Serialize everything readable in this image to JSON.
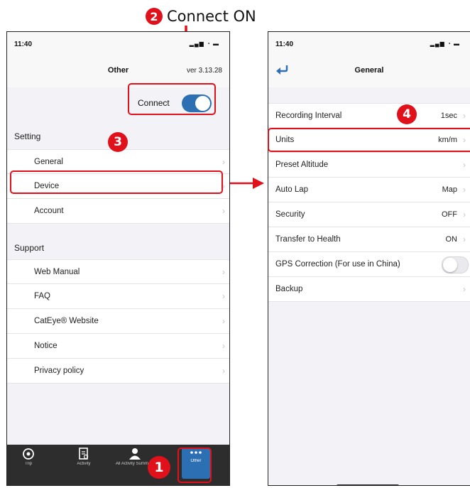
{
  "annotations": {
    "step1": "1",
    "step2": "2",
    "step2_label": "Connect ON",
    "step3": "3",
    "step4": "4",
    "accent_color": "#e0111b"
  },
  "left_screen": {
    "status_time": "11:40",
    "title": "Other",
    "version": "ver 3.13.28",
    "connect_label": "Connect",
    "connect_on": true,
    "sections": [
      {
        "header": "Setting",
        "items": [
          "General",
          "Device",
          "Account"
        ]
      },
      {
        "header": "Support",
        "items": [
          "Web Manual",
          "FAQ",
          "CatEye® Website",
          "Notice",
          "Privacy policy"
        ]
      }
    ],
    "tabs": [
      {
        "label": "Trip",
        "icon": "trip-icon"
      },
      {
        "label": "Activity",
        "icon": "activity-icon"
      },
      {
        "label": "All Activity Summary",
        "icon": "person-icon"
      },
      {
        "label": "Other",
        "icon": "more-icon",
        "active": true
      }
    ],
    "tab_active_color": "#2d6fb3"
  },
  "right_screen": {
    "status_time": "11:40",
    "title": "General",
    "rows": [
      {
        "label": "Recording Interval",
        "value": "1sec"
      },
      {
        "label": "Units",
        "value": "km/m"
      },
      {
        "label": "Preset Altitude",
        "value": ""
      },
      {
        "label": "Auto Lap",
        "value": "Map"
      },
      {
        "label": "Security",
        "value": "OFF"
      },
      {
        "label": "Transfer to Health",
        "value": "ON"
      },
      {
        "label": "GPS Correction (For use in China)",
        "value": "",
        "toggle": false
      },
      {
        "label": "Backup",
        "value": ""
      }
    ]
  }
}
